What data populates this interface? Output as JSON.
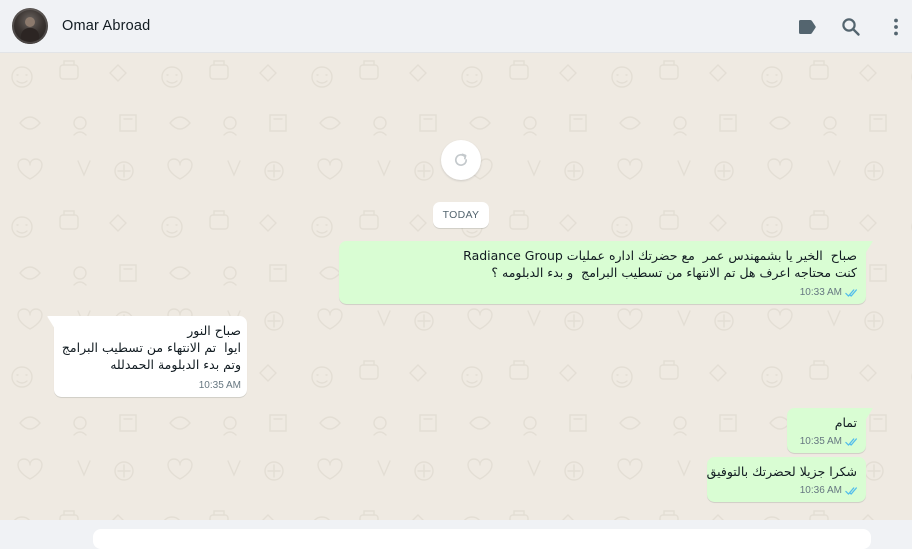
{
  "header": {
    "contact_name": "Omar Abroad",
    "icons": [
      "label-icon",
      "search-icon",
      "more-vertical-icon"
    ]
  },
  "chat": {
    "date_chip": "TODAY",
    "messages": [
      {
        "direction": "outgoing",
        "lines": [
          "صباح  الخير يا بشمهندس عمر  مع حضرتك اداره عمليات Radiance Group",
          "كنت محتاجه اعرف هل تم الانتهاء من تسطيب البرامج  و بدء الدبلومه ؟"
        ],
        "time": "10:33 AM",
        "status": "read"
      },
      {
        "direction": "incoming",
        "lines": [
          "صباح النور",
          "ايوا  تم الانتهاء من تسطيب البرامج",
          "وتم بدء الدبلومة الحمدلله"
        ],
        "time": "10:35 AM"
      },
      {
        "direction": "outgoing",
        "lines": [
          "تمام"
        ],
        "time": "10:35 AM",
        "status": "read"
      },
      {
        "direction": "outgoing",
        "lines": [
          "شكرا جزيلا لحضرتك بالتوفيق"
        ],
        "time": "10:36 AM",
        "status": "read"
      }
    ]
  },
  "colors": {
    "outgoing_bubble": "#d9fdd3",
    "incoming_bubble": "#ffffff",
    "read_ticks": "#53bdeb",
    "chat_background": "#efeae2",
    "header_background": "#f0f2f5"
  }
}
